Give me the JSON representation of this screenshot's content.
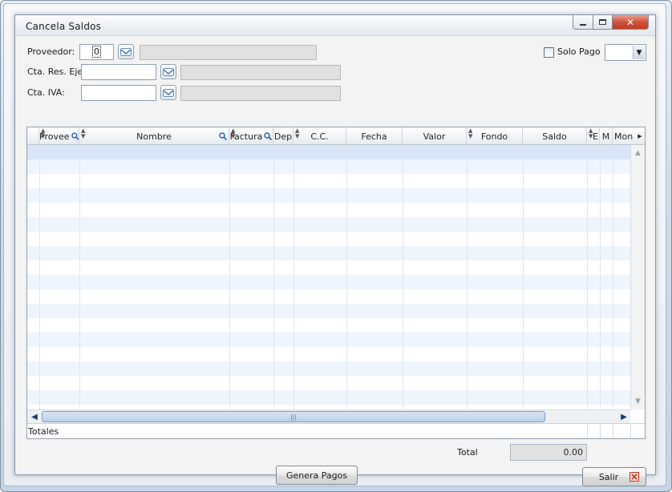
{
  "window": {
    "title": "Cancela Saldos"
  },
  "filters": {
    "proveedor_label": "Proveedor:",
    "proveedor_value": "0",
    "cta_res_label": "Cta. Res. Eje.",
    "cta_iva_label": "Cta. IVA:",
    "solo_pago_label": "Solo Pago"
  },
  "grid": {
    "columns": [
      "Provee",
      "Nombre",
      "Factura",
      "Dep",
      "C.C.",
      "Fecha",
      "Valor",
      "Fondo",
      "Saldo",
      "E",
      "M",
      "Mon"
    ],
    "totals_label": "Totales"
  },
  "footer": {
    "total_label": "Total",
    "total_value": "0.00",
    "genera_pagos_label": "Genera Pagos",
    "salir_label": "Salir"
  },
  "colors": {
    "accent": "#3a6ea5",
    "close": "#c13b24"
  },
  "icons": [
    "minimize-icon",
    "maximize-icon",
    "close-icon",
    "lookup-icon",
    "search-icon",
    "sort-icon",
    "chevron-down-icon",
    "scroll-arrow-icon",
    "exit-icon"
  ]
}
